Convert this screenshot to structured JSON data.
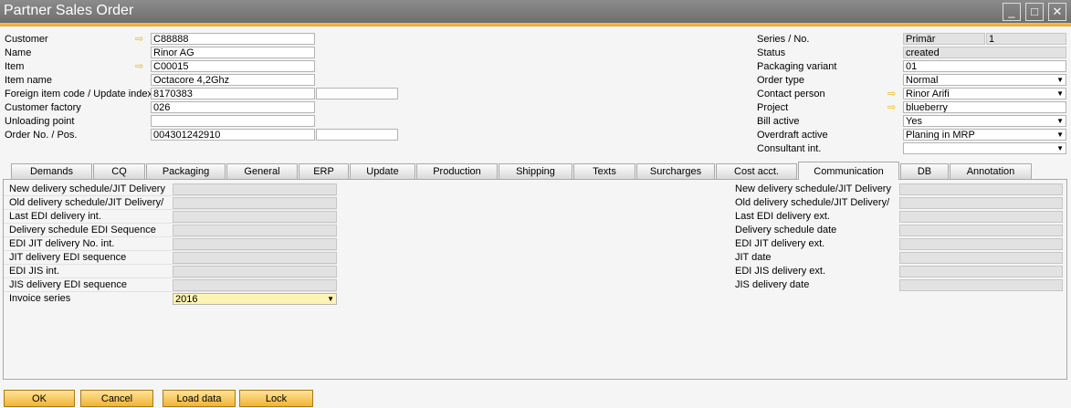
{
  "window": {
    "title": "Partner Sales Order"
  },
  "header_left": [
    {
      "label": "Customer",
      "arrow": true,
      "value": "C88888"
    },
    {
      "label": "Name",
      "arrow": false,
      "value": "Rinor AG"
    },
    {
      "label": "Item",
      "arrow": true,
      "value": "C00015"
    },
    {
      "label": "Item name",
      "arrow": false,
      "value": "Octacore 4,2Ghz"
    },
    {
      "label": "Foreign item code / Update index",
      "arrow": false,
      "value": "8170383",
      "value2": ""
    },
    {
      "label": "Customer factory",
      "arrow": false,
      "value": "026"
    },
    {
      "label": "Unloading point",
      "arrow": false,
      "value": ""
    },
    {
      "label": "Order No. / Pos.",
      "arrow": false,
      "value": "004301242910",
      "value2": ""
    }
  ],
  "header_right": [
    {
      "label": "Series / No.",
      "value": "Primär",
      "value2": "1",
      "kind": "split"
    },
    {
      "label": "Status",
      "value": "created",
      "kind": "disabled"
    },
    {
      "label": "Packaging variant",
      "value": "01",
      "kind": "text"
    },
    {
      "label": "Order type",
      "value": "Normal",
      "kind": "dropdown"
    },
    {
      "label": "Contact person",
      "value": "Rinor Arifi",
      "kind": "dropdown",
      "arrow": true
    },
    {
      "label": "Project",
      "value": "blueberry",
      "kind": "text",
      "arrow": true
    },
    {
      "label": "Bill active",
      "value": "Yes",
      "kind": "dropdown"
    },
    {
      "label": "Overdraft active",
      "value": "Planing in MRP",
      "kind": "dropdown"
    },
    {
      "label": "Consultant int.",
      "value": "",
      "kind": "dropdown"
    }
  ],
  "tabs": [
    "Demands",
    "CQ",
    "Packaging",
    "General",
    "ERP",
    "Update",
    "Production",
    "Shipping",
    "Texts",
    "Surcharges",
    "Cost acct.",
    "Communication",
    "DB",
    "Annotation"
  ],
  "active_tab": "Communication",
  "comm_left": [
    {
      "label": "New delivery schedule/JIT Delivery",
      "value": ""
    },
    {
      "label": "Old delivery schedule/JIT Delivery/",
      "value": ""
    },
    {
      "label": "Last EDI delivery int.",
      "value": ""
    },
    {
      "label": "Delivery schedule EDI Sequence",
      "value": ""
    },
    {
      "label": "EDI JIT delivery No. int.",
      "value": ""
    },
    {
      "label": "JIT delivery EDI sequence",
      "value": ""
    },
    {
      "label": "EDI JIS int.",
      "value": ""
    },
    {
      "label": "JIS delivery EDI sequence",
      "value": ""
    },
    {
      "label": "Invoice series",
      "value": "2016"
    }
  ],
  "comm_right": [
    {
      "label": "New delivery schedule/JIT Delivery",
      "value": ""
    },
    {
      "label": "Old delivery schedule/JIT Delivery/",
      "value": ""
    },
    {
      "label": "Last EDI delivery ext.",
      "value": ""
    },
    {
      "label": "Delivery schedule date",
      "value": ""
    },
    {
      "label": "EDI JIT delivery ext.",
      "value": ""
    },
    {
      "label": "JIT date",
      "value": ""
    },
    {
      "label": "EDI JIS delivery ext.",
      "value": ""
    },
    {
      "label": "JIS delivery date",
      "value": ""
    }
  ],
  "buttons": {
    "ok": "OK",
    "cancel": "Cancel",
    "load": "Load data",
    "lock": "Lock"
  },
  "icons": {
    "minimize": "minimize-icon",
    "maximize": "maximize-icon",
    "close": "close-icon",
    "link_arrow": "link-arrow-icon",
    "dropdown": "chevron-down-icon"
  },
  "colors": {
    "accent": "#f1b334",
    "titlebar": "#7a7a7a",
    "link_arrow": "#f0b400",
    "selected_field": "#fdf4b4"
  }
}
